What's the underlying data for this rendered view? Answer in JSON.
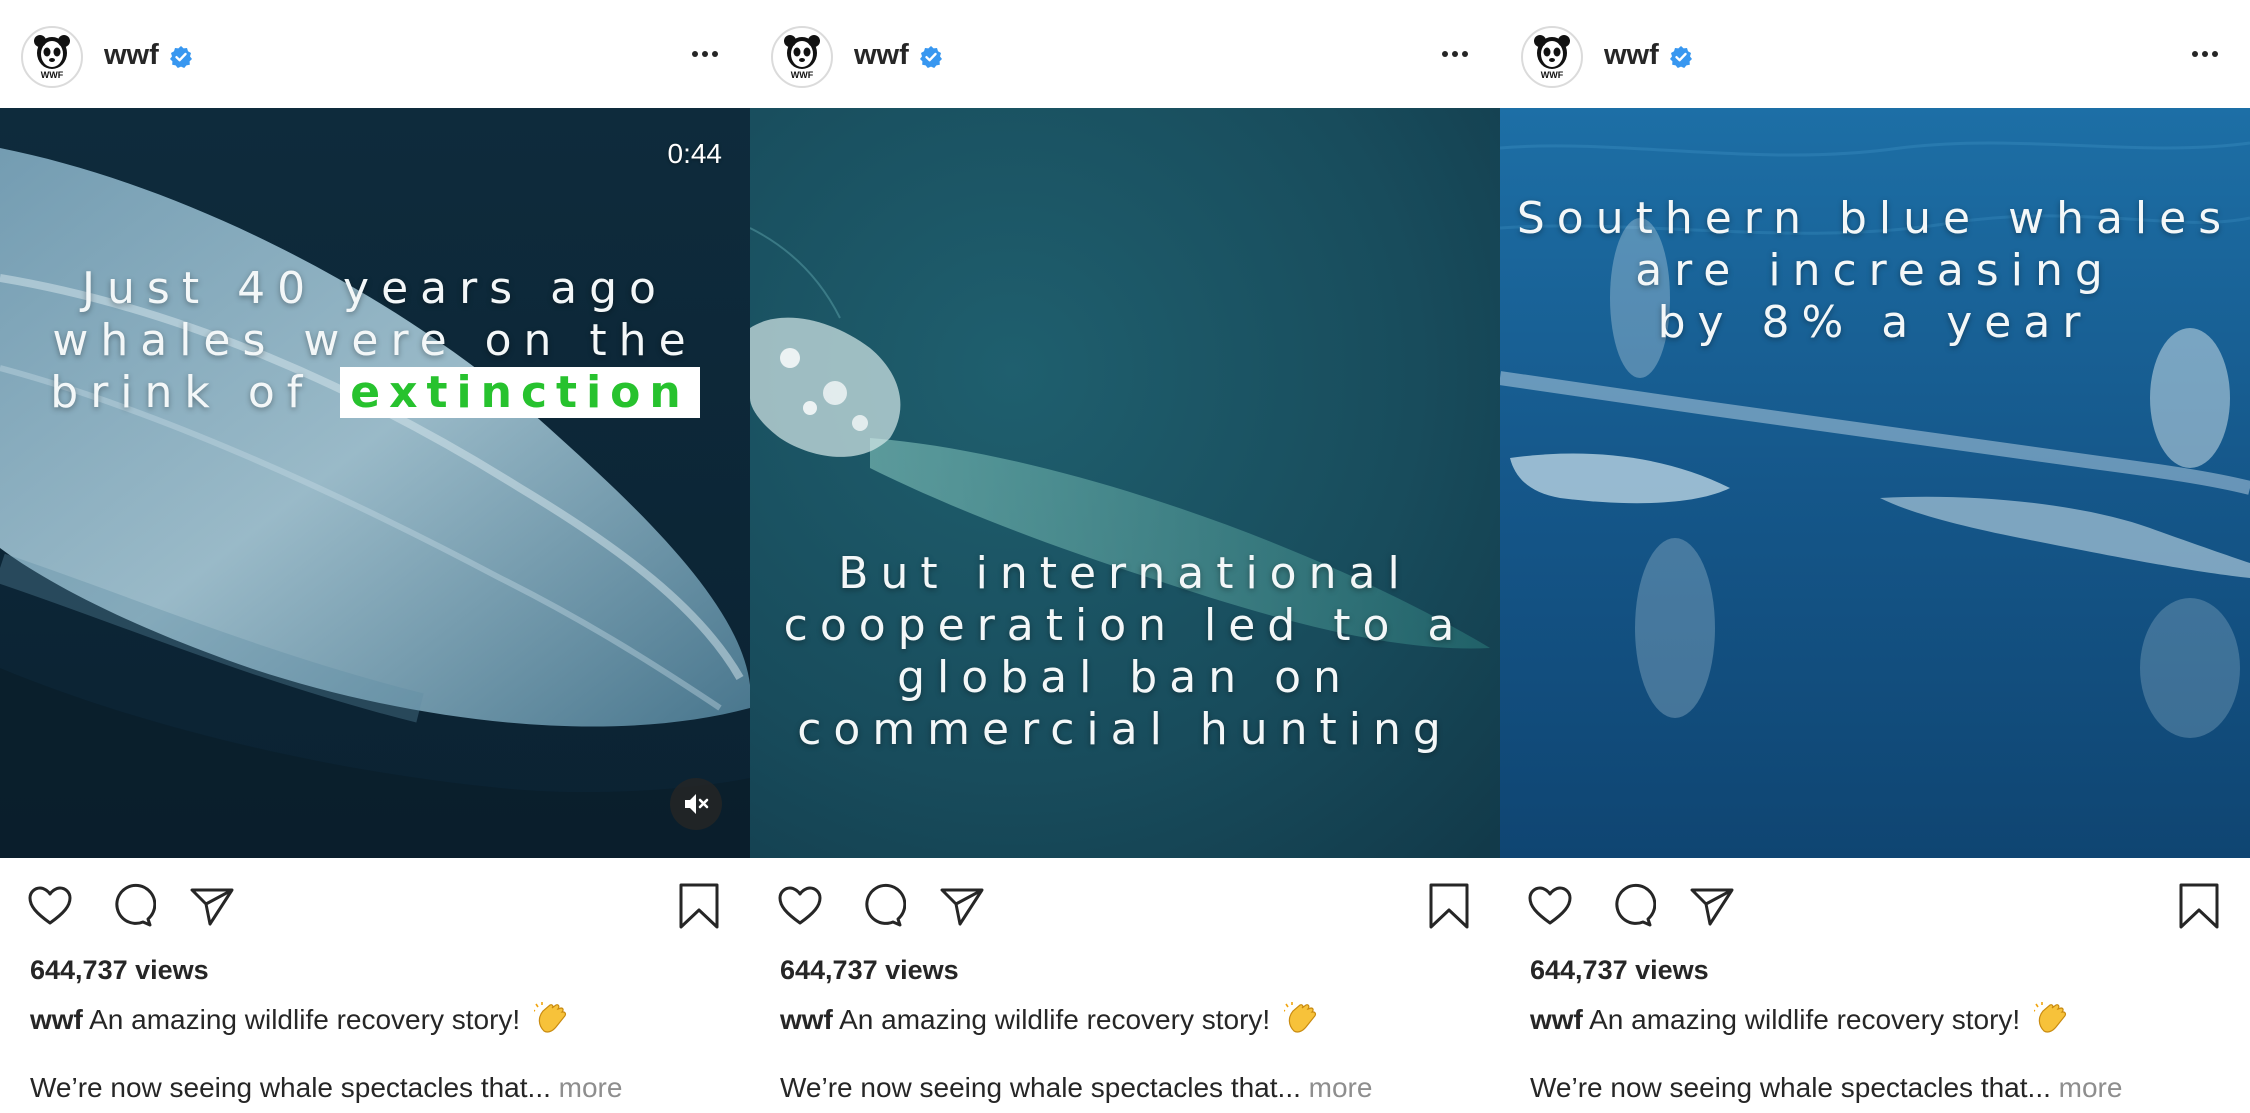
{
  "posts": [
    {
      "username": "wwf",
      "overlay_lines": [
        "Just 40 years ago",
        "whales were on the",
        "brink of"
      ],
      "overlay_highlight": "extinction",
      "timer": "0:44",
      "views": "644,737 views",
      "caption_user": "wwf",
      "caption_text": "An amazing wildlife recovery story!",
      "caption_more_text": "We’re now seeing whale spectacles that...",
      "more_label": "more"
    },
    {
      "username": "wwf",
      "overlay_lines": [
        "But international",
        "cooperation led to a",
        "global ban on",
        "commercial hunting"
      ],
      "views": "644,737 views",
      "caption_user": "wwf",
      "caption_text": "An amazing wildlife recovery story!",
      "caption_more_text": "We’re now seeing whale spectacles that...",
      "more_label": "more"
    },
    {
      "username": "wwf",
      "overlay_lines": [
        "Southern blue whales",
        "are increasing",
        "by 8% a year"
      ],
      "views": "644,737 views",
      "caption_user": "wwf",
      "caption_text": "An amazing wildlife recovery story!",
      "caption_more_text": "We’re now seeing whale spectacles that...",
      "more_label": "more"
    }
  ],
  "icons": {
    "avatar": "wwf-panda-logo-icon",
    "verified": "verified-badge-icon",
    "more": "more-options-icon",
    "like": "heart-icon",
    "comment": "comment-icon",
    "share": "paper-plane-icon",
    "save": "bookmark-icon",
    "mute": "muted-speaker-icon",
    "clap": "clapping-hands-emoji"
  },
  "colors": {
    "verified": "#3897f0",
    "highlight_text": "#27c22e",
    "muted_text": "#8e8e8e"
  }
}
